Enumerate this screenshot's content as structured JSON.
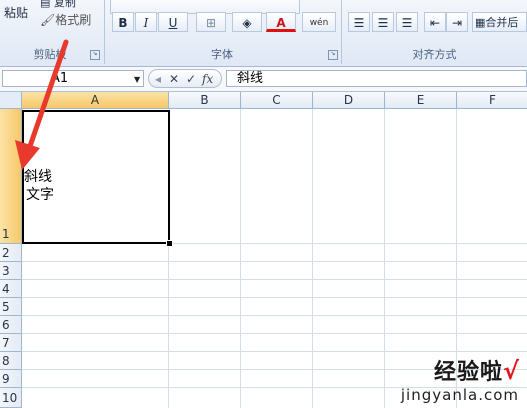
{
  "ribbon": {
    "clipboard": {
      "paste_label": "粘贴",
      "copy_label": "复制",
      "format_painter_label": "格式刷",
      "group_label": "剪贴板"
    },
    "font": {
      "bold": "B",
      "italic": "I",
      "underline": "U",
      "font_color_glyph": "A",
      "phonetic_glyph": "wén",
      "group_label": "字体"
    },
    "alignment": {
      "merge_label": "合并后",
      "group_label": "对齐方式"
    },
    "launcher_glyph": "↘"
  },
  "formula_bar": {
    "name_box": "A1",
    "cancel_glyph": "✕",
    "enter_glyph": "✓",
    "fx_glyph": "fx",
    "content": "斜线"
  },
  "sheet": {
    "columns": [
      "A",
      "B",
      "C",
      "D",
      "E",
      "F"
    ],
    "rows": [
      "1",
      "2",
      "3",
      "4",
      "5",
      "6",
      "7",
      "8",
      "9",
      "10"
    ],
    "selected_cell": "A1",
    "cell_a1_line1": "斜线",
    "cell_a1_line2": "文字"
  },
  "annotation": {
    "arrow_color": "#e8392c"
  },
  "watermark": {
    "cn": "经验啦",
    "check": "√",
    "url": "jingyanla.com"
  },
  "colors": {
    "selected_header": "#f7c86a",
    "ribbon_bg": "#dfe8f5",
    "grid_line": "#d5dde8"
  }
}
